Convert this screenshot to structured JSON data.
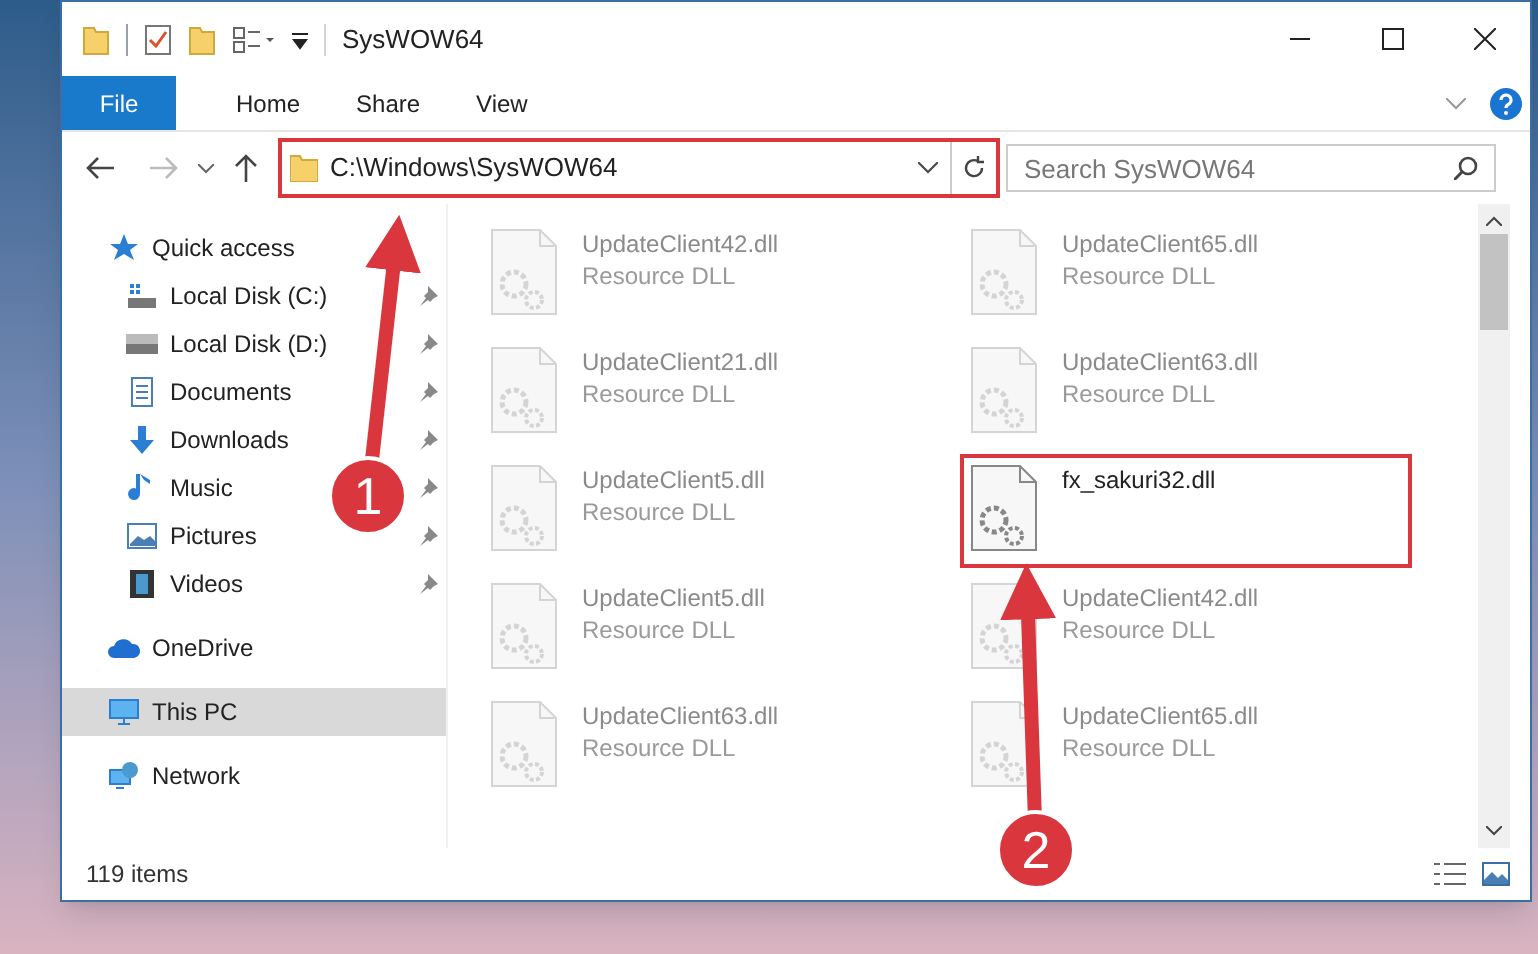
{
  "window": {
    "title": "SysWOW64"
  },
  "ribbon_tabs": [
    {
      "label": "File",
      "selected": true
    },
    {
      "label": "Home",
      "selected": false
    },
    {
      "label": "Share",
      "selected": false
    },
    {
      "label": "View",
      "selected": false
    }
  ],
  "address_bar": {
    "value": "C:\\Windows\\SysWOW64",
    "highlighted": true
  },
  "search": {
    "placeholder": "Search SysWOW64"
  },
  "sidebar": {
    "items": [
      {
        "label": "Quick access",
        "kind": "star",
        "pinned": false,
        "selected": false,
        "group": true
      },
      {
        "label": "Local Disk (C:)",
        "kind": "drive-c",
        "pinned": true,
        "selected": false,
        "group": false
      },
      {
        "label": "Local Disk (D:)",
        "kind": "drive",
        "pinned": true,
        "selected": false,
        "group": false
      },
      {
        "label": "Documents",
        "kind": "document",
        "pinned": true,
        "selected": false,
        "group": false
      },
      {
        "label": "Downloads",
        "kind": "download",
        "pinned": true,
        "selected": false,
        "group": false
      },
      {
        "label": "Music",
        "kind": "music",
        "pinned": true,
        "selected": false,
        "group": false
      },
      {
        "label": "Pictures",
        "kind": "picture",
        "pinned": true,
        "selected": false,
        "group": false
      },
      {
        "label": "Videos",
        "kind": "video",
        "pinned": true,
        "selected": false,
        "group": false
      },
      {
        "label": "OneDrive",
        "kind": "cloud",
        "pinned": false,
        "selected": false,
        "group": true
      },
      {
        "label": "This PC",
        "kind": "computer",
        "pinned": false,
        "selected": true,
        "group": true
      },
      {
        "label": "Network",
        "kind": "network",
        "pinned": false,
        "selected": false,
        "group": true
      }
    ]
  },
  "files": [
    {
      "name": "UpdateClient42.dll",
      "subtitle": "Resource DLL",
      "faded": true,
      "highlighted": false
    },
    {
      "name": "UpdateClient65.dll",
      "subtitle": "Resource DLL",
      "faded": true,
      "highlighted": false
    },
    {
      "name": "UpdateClient21.dll",
      "subtitle": "Resource DLL",
      "faded": true,
      "highlighted": false
    },
    {
      "name": "UpdateClient63.dll",
      "subtitle": "Resource DLL",
      "faded": true,
      "highlighted": false
    },
    {
      "name": "UpdateClient5.dll",
      "subtitle": "Resource DLL",
      "faded": true,
      "highlighted": false
    },
    {
      "name": "fx_sakuri32.dll",
      "faded": false,
      "highlighted": true
    },
    {
      "name": "UpdateClient5.dll",
      "subtitle": "Resource DLL",
      "faded": true,
      "highlighted": false
    },
    {
      "name": "UpdateClient42.dll",
      "subtitle": "Resource DLL",
      "faded": true,
      "highlighted": false
    },
    {
      "name": "UpdateClient63.dll",
      "subtitle": "Resource DLL",
      "faded": true,
      "highlighted": false
    },
    {
      "name": "UpdateClient65.dll",
      "subtitle": "Resource DLL",
      "faded": true,
      "highlighted": false
    }
  ],
  "status_bar": {
    "item_count": "119 items"
  },
  "callouts": [
    {
      "number": "1"
    },
    {
      "number": "2"
    }
  ]
}
